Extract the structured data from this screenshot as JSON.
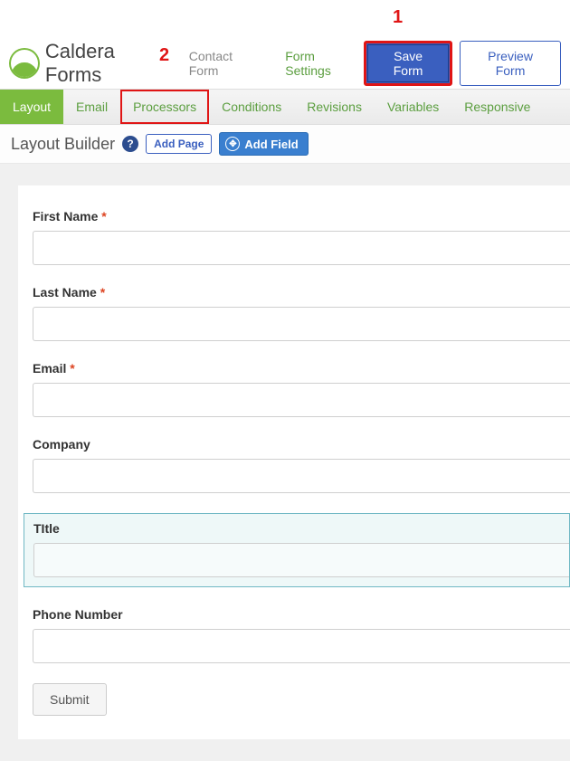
{
  "header": {
    "brand": "Caldera Forms",
    "form_name": "Contact Form",
    "form_settings": "Form Settings",
    "save": "Save Form",
    "preview": "Preview Form"
  },
  "annotations": {
    "a1": "1",
    "a2": "2"
  },
  "tabs": {
    "layout": "Layout",
    "email": "Email",
    "processors": "Processors",
    "conditions": "Conditions",
    "revisions": "Revisions",
    "variables": "Variables",
    "responsive": "Responsive"
  },
  "subhead": {
    "title": "Layout Builder",
    "help": "?",
    "add_page": "Add Page",
    "add_field": "Add Field",
    "move_glyph": "✥"
  },
  "fields": {
    "first_name": {
      "label": "First Name",
      "required": "*"
    },
    "last_name": {
      "label": "Last Name",
      "required": "*"
    },
    "email": {
      "label": "Email",
      "required": "*"
    },
    "company": {
      "label": "Company"
    },
    "title": {
      "label": "TItle"
    },
    "phone": {
      "label": "Phone Number"
    },
    "submit": "Submit"
  }
}
